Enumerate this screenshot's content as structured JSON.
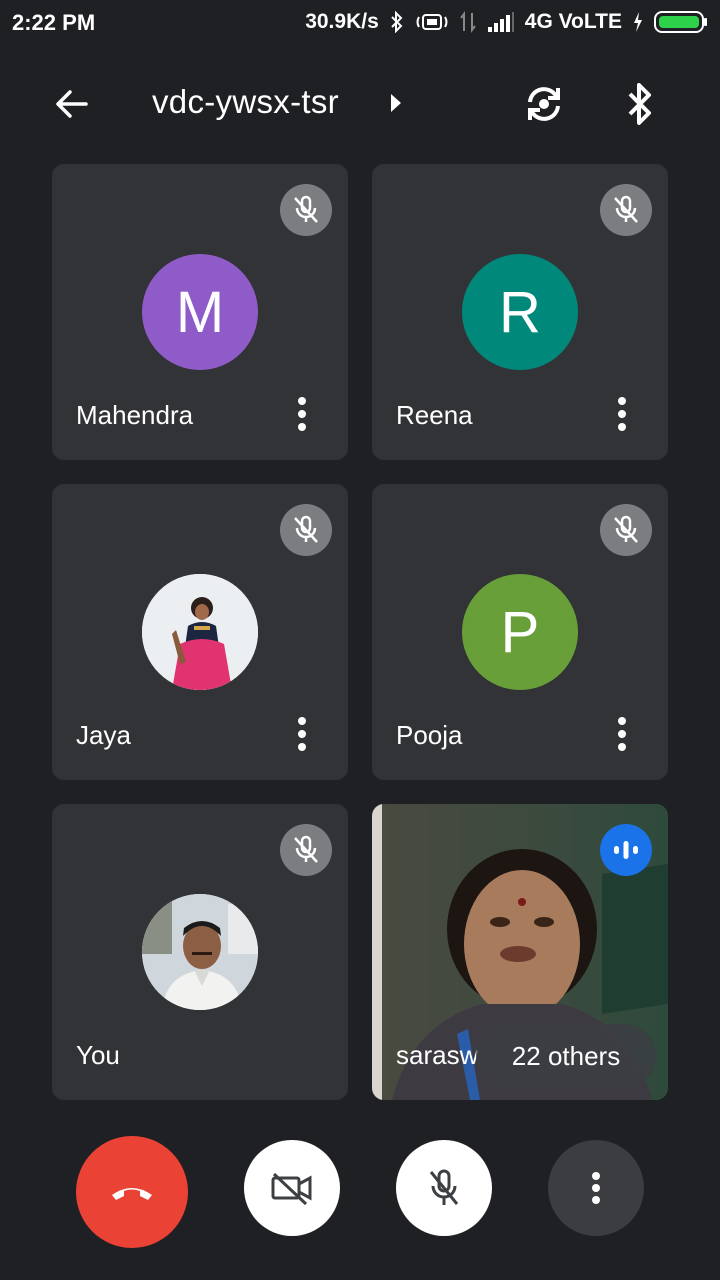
{
  "status_bar": {
    "time": "2:22 PM",
    "speed": "30.9K/s",
    "network": "4G VoLTE"
  },
  "toolbar": {
    "meeting_code": "vdc-ywsx-tsr",
    "icons": [
      "back-arrow-icon",
      "chevron-right-icon",
      "switch-camera-icon",
      "bluetooth-icon"
    ]
  },
  "participants": [
    {
      "name": "Mahendra",
      "initial": "M",
      "avatar_color": "#8e5bc8",
      "muted": true
    },
    {
      "name": "Reena",
      "initial": "R",
      "avatar_color": "#00897b",
      "muted": true
    },
    {
      "name": "Jaya",
      "initial": "",
      "avatar_color": "#e9ecef",
      "muted": true
    },
    {
      "name": "Pooja",
      "initial": "P",
      "avatar_color": "#689f38",
      "muted": true
    },
    {
      "name": "You",
      "initial": "",
      "avatar_color": "#d7dbe0",
      "muted": true
    },
    {
      "name": "sarasw",
      "others_label": "22 others",
      "speaking": true
    }
  ],
  "controls": {
    "end_call_color": "#ea4335",
    "icons": [
      "end-call-icon",
      "camera-off-icon",
      "mic-off-icon",
      "more-vert-icon"
    ]
  }
}
